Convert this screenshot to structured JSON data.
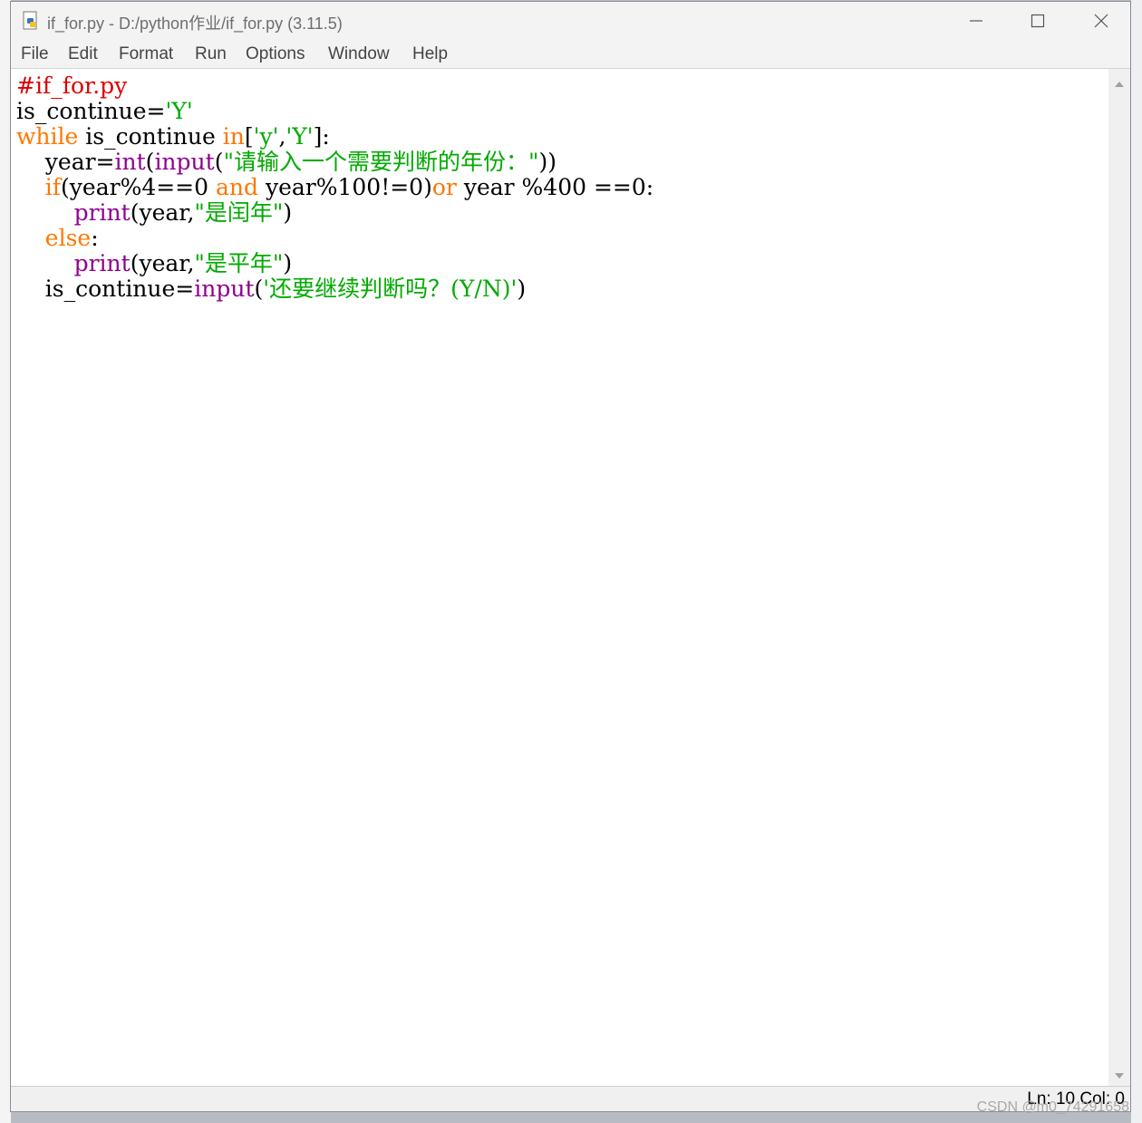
{
  "window": {
    "title": "if_for.py - D:/python作业/if_for.py (3.11.5)"
  },
  "menu": [
    "File",
    "Edit",
    "Format",
    "Run",
    "Options",
    "Window",
    "Help"
  ],
  "code": [
    [
      {
        "t": "#if_for.py",
        "c": "cm"
      }
    ],
    [
      {
        "t": "is_continue=",
        "c": ""
      },
      {
        "t": "'Y'",
        "c": "st"
      }
    ],
    [
      {
        "t": "while",
        "c": "kw"
      },
      {
        "t": " is_continue ",
        "c": ""
      },
      {
        "t": "in",
        "c": "kw"
      },
      {
        "t": "[",
        "c": ""
      },
      {
        "t": "'y'",
        "c": "st"
      },
      {
        "t": ",",
        "c": ""
      },
      {
        "t": "'Y'",
        "c": "st"
      },
      {
        "t": "]:",
        "c": ""
      }
    ],
    [
      {
        "t": "    year=",
        "c": ""
      },
      {
        "t": "int",
        "c": "bi"
      },
      {
        "t": "(",
        "c": ""
      },
      {
        "t": "input",
        "c": "bi"
      },
      {
        "t": "(",
        "c": ""
      },
      {
        "t": "\"请输入一个需要判断的年份：\"",
        "c": "st"
      },
      {
        "t": "))",
        "c": ""
      }
    ],
    [
      {
        "t": "    ",
        "c": ""
      },
      {
        "t": "if",
        "c": "kw"
      },
      {
        "t": "(year%4==0 ",
        "c": ""
      },
      {
        "t": "and",
        "c": "kw"
      },
      {
        "t": " year%100!=0)",
        "c": ""
      },
      {
        "t": "or",
        "c": "kw"
      },
      {
        "t": " year %400 ==0:",
        "c": ""
      }
    ],
    [
      {
        "t": "        ",
        "c": ""
      },
      {
        "t": "print",
        "c": "bi"
      },
      {
        "t": "(year,",
        "c": ""
      },
      {
        "t": "\"是闰年\"",
        "c": "st"
      },
      {
        "t": ")",
        "c": ""
      }
    ],
    [
      {
        "t": "    ",
        "c": ""
      },
      {
        "t": "else",
        "c": "kw"
      },
      {
        "t": ":",
        "c": ""
      }
    ],
    [
      {
        "t": "        ",
        "c": ""
      },
      {
        "t": "print",
        "c": "bi"
      },
      {
        "t": "(year,",
        "c": ""
      },
      {
        "t": "\"是平年\"",
        "c": "st"
      },
      {
        "t": ")",
        "c": ""
      }
    ],
    [
      {
        "t": "    is_continue=",
        "c": ""
      },
      {
        "t": "input",
        "c": "bi"
      },
      {
        "t": "(",
        "c": ""
      },
      {
        "t": "'还要继续判断吗？(Y/N)'",
        "c": "st"
      },
      {
        "t": ")",
        "c": ""
      }
    ]
  ],
  "status": {
    "position": "Ln: 10  Col: 0"
  },
  "watermark": "CSDN @m0_74291658",
  "colors": {
    "keyword": "#ff7700",
    "builtin": "#900090",
    "string": "#00aa00",
    "comment": "#dd0000"
  }
}
